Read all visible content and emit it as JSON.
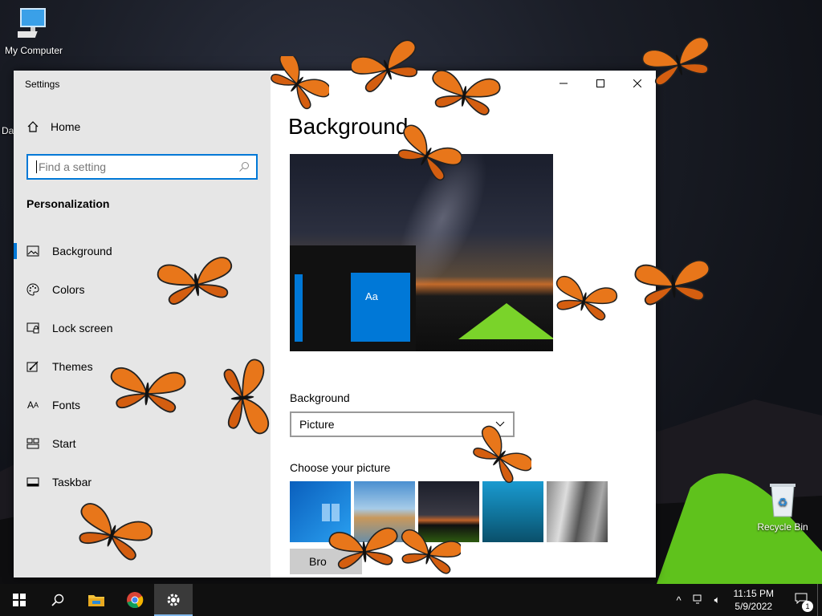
{
  "desktop": {
    "icons": [
      {
        "label": "My Computer",
        "icon": "computer-icon"
      },
      {
        "label": "Recycle Bin",
        "icon": "recycle-bin-icon"
      }
    ],
    "partial_icon_label": "Da"
  },
  "window": {
    "title": "Settings",
    "controls": {
      "minimize": "—",
      "maximize": "☐",
      "close": "✕"
    }
  },
  "sidebar": {
    "home_label": "Home",
    "search_placeholder": "Find a setting",
    "section_header": "Personalization",
    "items": [
      {
        "label": "Background",
        "icon": "picture-icon",
        "active": true
      },
      {
        "label": "Colors",
        "icon": "palette-icon"
      },
      {
        "label": "Lock screen",
        "icon": "lock-screen-icon"
      },
      {
        "label": "Themes",
        "icon": "themes-icon"
      },
      {
        "label": "Fonts",
        "icon": "fonts-icon"
      },
      {
        "label": "Start",
        "icon": "start-icon"
      },
      {
        "label": "Taskbar",
        "icon": "taskbar-icon"
      }
    ]
  },
  "main": {
    "title": "Background",
    "preview_tile_text": "Aa",
    "background_label": "Background",
    "background_value": "Picture",
    "choose_label": "Choose your picture",
    "browse_label": "Bro"
  },
  "taskbar": {
    "apps": [
      "start-icon",
      "search-icon",
      "file-explorer-icon",
      "chrome-icon",
      "settings-icon"
    ],
    "time": "11:15 PM",
    "date": "5/9/2022",
    "notification_count": "1"
  },
  "colors": {
    "accent": "#0078d7",
    "butterfly": "#e8761a"
  }
}
